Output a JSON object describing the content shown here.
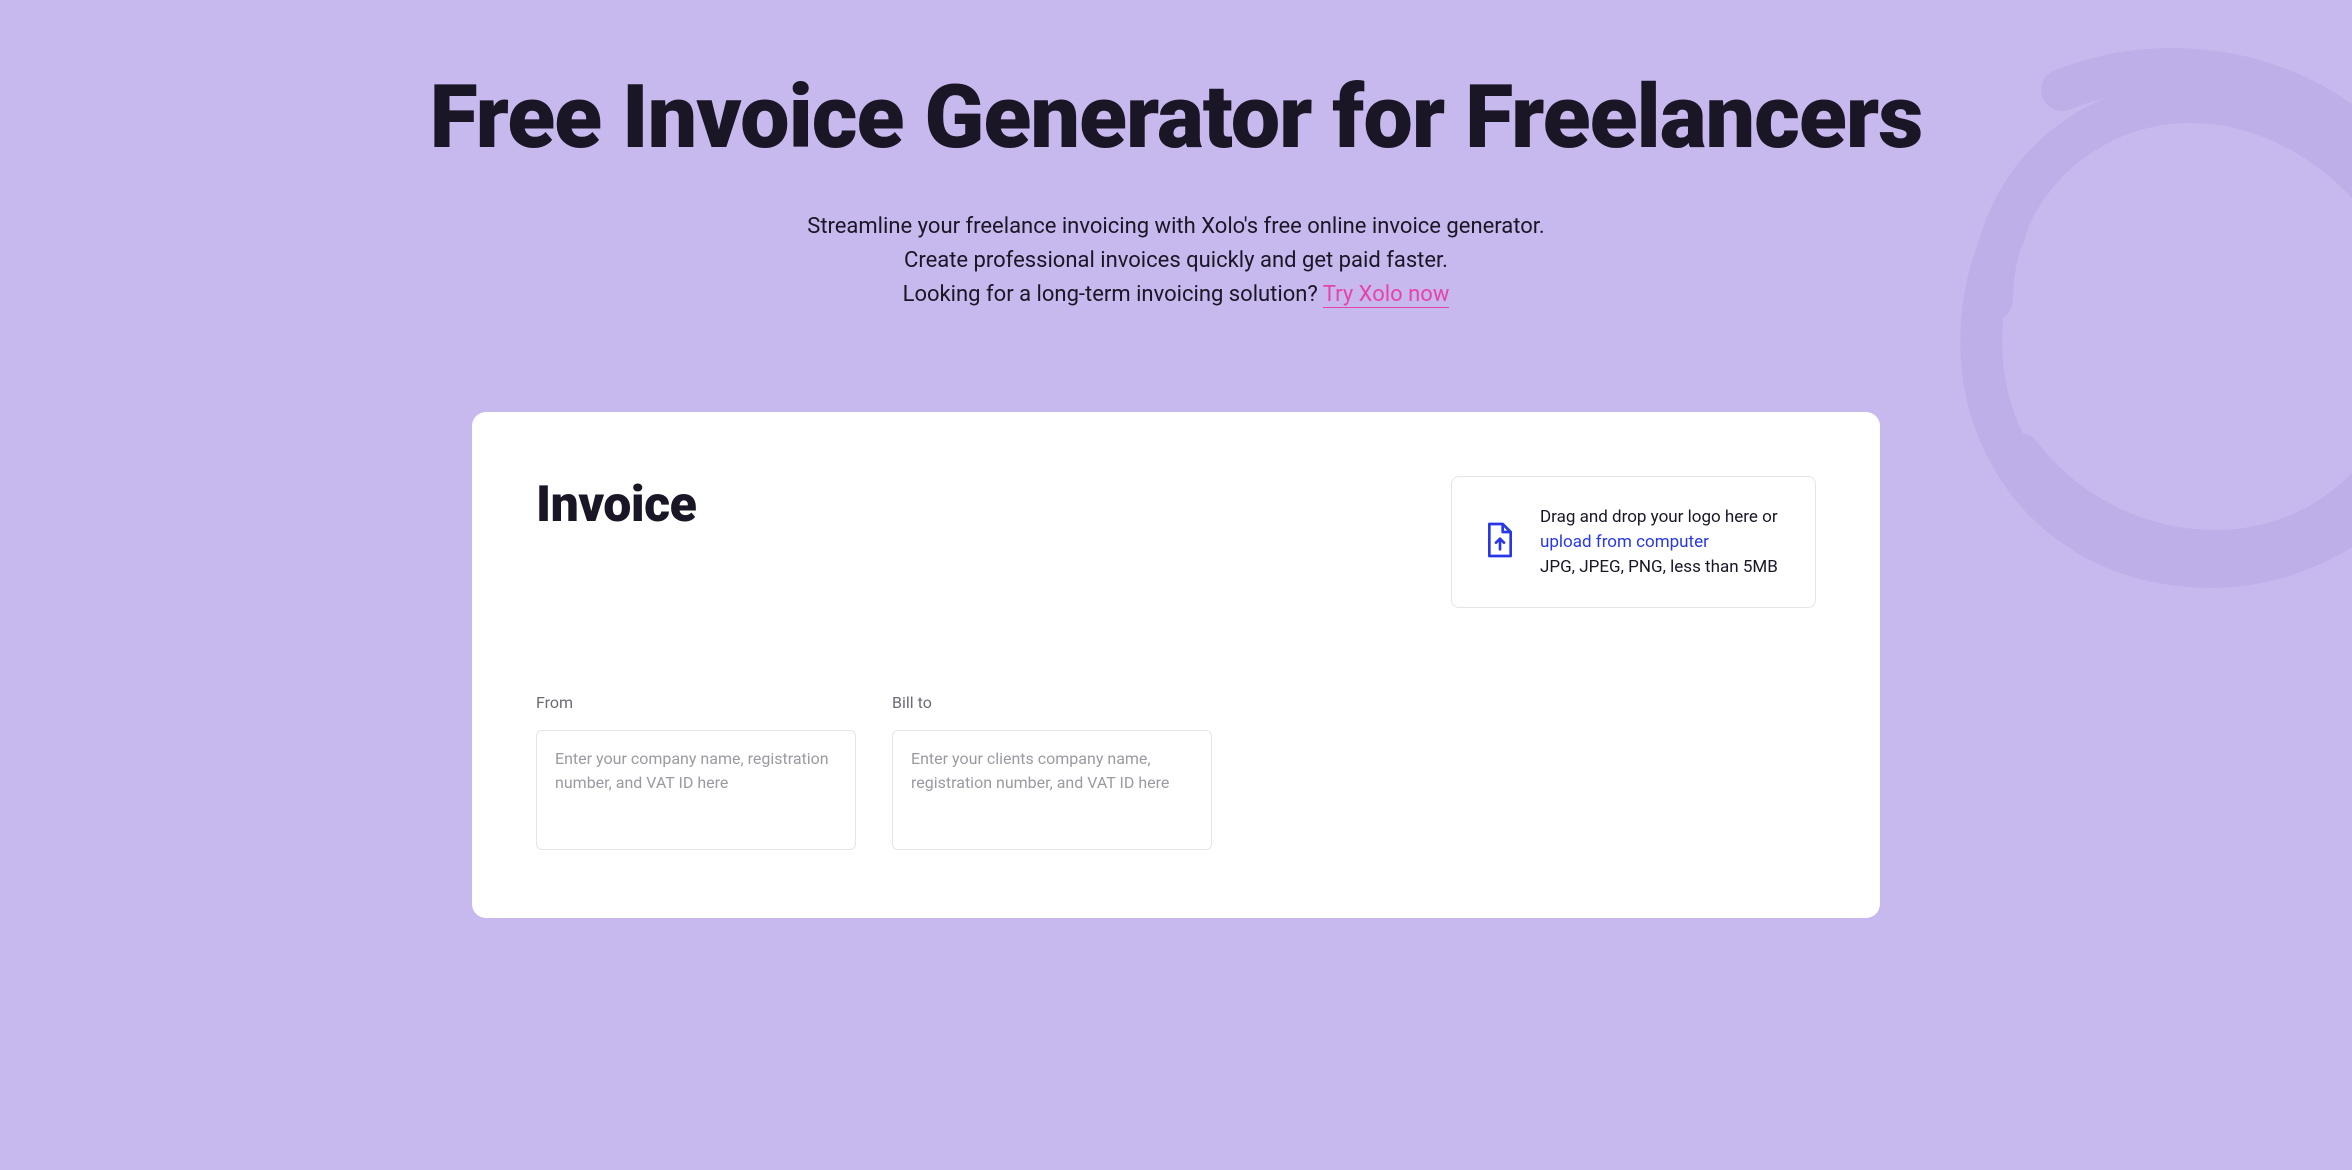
{
  "hero": {
    "title": "Free Invoice Generator for Freelancers",
    "subtitle_line1": "Streamline your freelance invoicing with Xolo's free online invoice generator.",
    "subtitle_line2": "Create professional invoices quickly and get paid faster.",
    "subtitle_line3_prefix": "Looking for a long-term invoicing solution? ",
    "cta_link": "Try Xolo now"
  },
  "invoice": {
    "title": "Invoice",
    "upload": {
      "drag_text": "Drag and drop your logo here or ",
      "link_text": "upload from computer",
      "format_text": "JPG, JPEG, PNG, less than 5MB"
    },
    "from": {
      "label": "From",
      "placeholder": "Enter your company name, registration number, and VAT ID here"
    },
    "bill_to": {
      "label": "Bill to",
      "placeholder": "Enter your clients company name, registration number, and VAT ID here"
    }
  }
}
